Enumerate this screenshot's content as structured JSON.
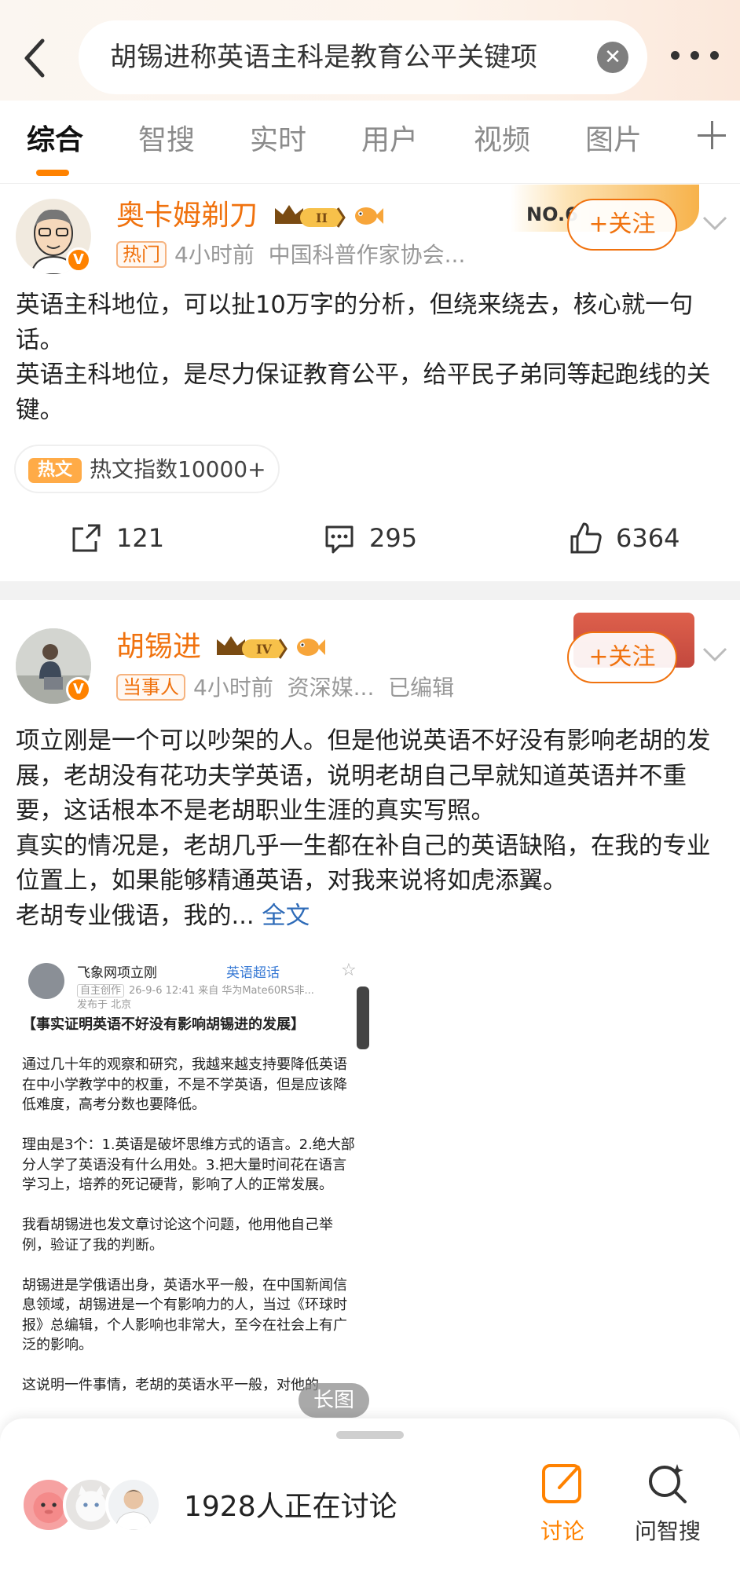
{
  "search": {
    "query": "胡锡进称英语主科是教育公平关键项"
  },
  "tabs": [
    {
      "label": "综合"
    },
    {
      "label": "智搜"
    },
    {
      "label": "实时"
    },
    {
      "label": "用户"
    },
    {
      "label": "视频"
    },
    {
      "label": "图片"
    }
  ],
  "post1": {
    "author": "奥卡姆剃刀",
    "vip_level": "II",
    "badge_label": "NO.6",
    "tag": "热门",
    "time": "4小时前",
    "source": "中国科普作家协会...",
    "follow_label": "+关注",
    "text": "英语主科地位，可以扯10万字的分析，但绕来绕去，核心就一句话。\n英语主科地位，是尽力保证教育公平，给平民子弟同等起跑线的关键。",
    "hot_icon": "热文",
    "hot_text": "热文指数10000+",
    "reposts": "121",
    "comments": "295",
    "likes": "6364"
  },
  "post2": {
    "author": "胡锡进",
    "vip_level": "IV",
    "tag": "当事人",
    "time": "4小时前",
    "source": "资深媒...",
    "edited": "已编辑",
    "follow_label": "+关注",
    "text": "项立刚是一个可以吵架的人。但是他说英语不好没有影响老胡的发展，老胡没有花功夫学英语，说明老胡自己早就知道英语并不重要，这话根本不是老胡职业生涯的真实写照。\n真实的情况是，老胡几乎一生都在补自己的英语缺陷，在我的专业位置上，如果能够精通英语，对我来说将如虎添翼。\n老胡专业俄语，我的...",
    "full_text_link": "全文",
    "embed": {
      "author": "飞象网项立刚",
      "topic": "英语超话",
      "self_tag": "自主创作",
      "meta": "26-9-6 12:41  来自 华为Mate60RS非...",
      "location": "发布于 北京",
      "title": "【事实证明英语不好没有影响胡锡进的发展】",
      "paragraphs": [
        "通过几十年的观察和研究，我越来越支持要降低英语在中小学教学中的权重，不是不学英语，但是应该降低难度，高考分数也要降低。",
        "理由是3个：1.英语是破坏思维方式的语言。2.绝大部分人学了英语没有什么用处。3.把大量时间花在语言学习上，培养的死记硬背，影响了人的正常发展。",
        "我看胡锡进也发文章讨论这个问题，他用他自己举例，验证了我的判断。",
        "胡锡进是学俄语出身，英语水平一般，在中国新闻信息领域，胡锡进是一个有影响力的人，当过《环球时报》总编辑，个人影响也非常大，至今在社会上有广泛的影响。",
        "这说明一件事情，老胡的英语水平一般，对他的"
      ],
      "long_image_label": "长图"
    }
  },
  "bottom": {
    "discussing": "1928人正在讨论",
    "discuss_label": "讨论",
    "ask_label": "问智搜"
  },
  "colors": {
    "accent": "#ff8200",
    "name": "#f0720e",
    "link": "#2e6bb8"
  }
}
